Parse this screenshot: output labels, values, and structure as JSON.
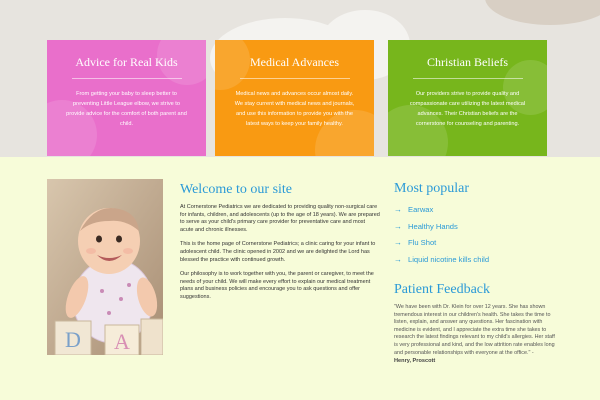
{
  "cards": [
    {
      "title": "Advice for Real Kids",
      "text": "From getting your baby to sleep better to preventing Little League elbow, we strive to provide advice for the comfort of both parent and child.",
      "color": "#e96fcb"
    },
    {
      "title": "Medical Advances",
      "text": "Medical news and advances occur almost daily. We stay current with medical news and journals, and use this information to provide you with the latest ways to keep your family healthy.",
      "color": "#f99a12"
    },
    {
      "title": "Christian Beliefs",
      "text": "Our providers strive to provide quality and compassionate care utilizing the latest medical advances. Their Christian beliefs are the cornerstone for counseling and parenting.",
      "color": "#77b61c"
    }
  ],
  "welcome": {
    "title": "Welcome to our site",
    "paragraphs": [
      "At Cornerstone Pediatrics we are dedicated to providing quality non-surgical care for infants, children, and adolescents (up to the age of 18 years). We are prepared to serve as your child's primary care provider for preventative care and most acute and chronic illnesses.",
      "This is the home page of Cornerstone Pediatrics; a clinic caring for your infant to adolescent child. The clinic opened in 2002 and we are delighted the Lord has blessed the practice with continued growth.",
      "Our philosophy is to work together with you, the parent or caregiver, to meet the needs of your child. We will make every effort to explain our medical treatment plans and business policies and encourage you to ask questions and offer suggestions."
    ]
  },
  "popular": {
    "title": "Most popular",
    "arrow": "→",
    "links": [
      "Earwax",
      "Healthy Hands",
      "Flu Shot",
      "Liquid nicotine kills child"
    ]
  },
  "feedback": {
    "title": "Patient Feedback",
    "quote": "\"We have been with Dr. Klein for over 12 years. She has shown tremendous interest in our children's health. She takes the time to listen, explain, and answer any questions. Her fascination with medicine is evident, and I appreciate the extra time she takes to research the latest findings relevant to my child's allergies. Her staff is very professional and kind, and the low attrition rate enables long and personable relationships with everyone at the office.\" -",
    "author": "Henry, Proscott"
  },
  "colors": {
    "accent": "#2b9ad7",
    "page_background": "#f7fcd9",
    "hero_background": "#e7e4df"
  }
}
